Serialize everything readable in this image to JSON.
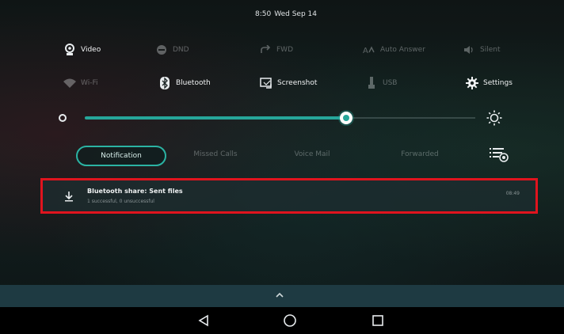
{
  "status_bar": {
    "time": "8:50",
    "date": "Wed Sep 14"
  },
  "quick_settings": {
    "row1": [
      {
        "label": "Video",
        "icon": "video-camera-icon",
        "active": true
      },
      {
        "label": "DND",
        "icon": "dnd-icon",
        "active": false
      },
      {
        "label": "FWD",
        "icon": "forward-icon",
        "active": false
      },
      {
        "label": "Auto Answer",
        "icon": "auto-answer-icon",
        "active": false
      },
      {
        "label": "Silent",
        "icon": "speaker-icon",
        "active": false
      }
    ],
    "row2": [
      {
        "label": "Wi-Fi",
        "icon": "wifi-icon",
        "active": false
      },
      {
        "label": "Bluetooth",
        "icon": "bluetooth-icon",
        "active": true
      },
      {
        "label": "Screenshot",
        "icon": "screenshot-icon",
        "active": true
      },
      {
        "label": "USB",
        "icon": "usb-icon",
        "active": false
      },
      {
        "label": "Settings",
        "icon": "gear-icon",
        "active": true
      }
    ]
  },
  "brightness": {
    "level": 0.67,
    "accent": "#26a69a"
  },
  "tabs": [
    {
      "label": "Notification",
      "active": true
    },
    {
      "label": "Missed Calls",
      "active": false
    },
    {
      "label": "Voice Mail",
      "active": false
    },
    {
      "label": "Forwarded",
      "active": false
    }
  ],
  "notification": {
    "title": "Bluetooth share: Sent files",
    "subtitle": "1 successful, 0 unsuccessful",
    "time": "08:49",
    "highlight_color": "#e0141e"
  },
  "nav": {
    "back": "back-icon",
    "home": "home-icon",
    "recents": "recents-icon"
  }
}
